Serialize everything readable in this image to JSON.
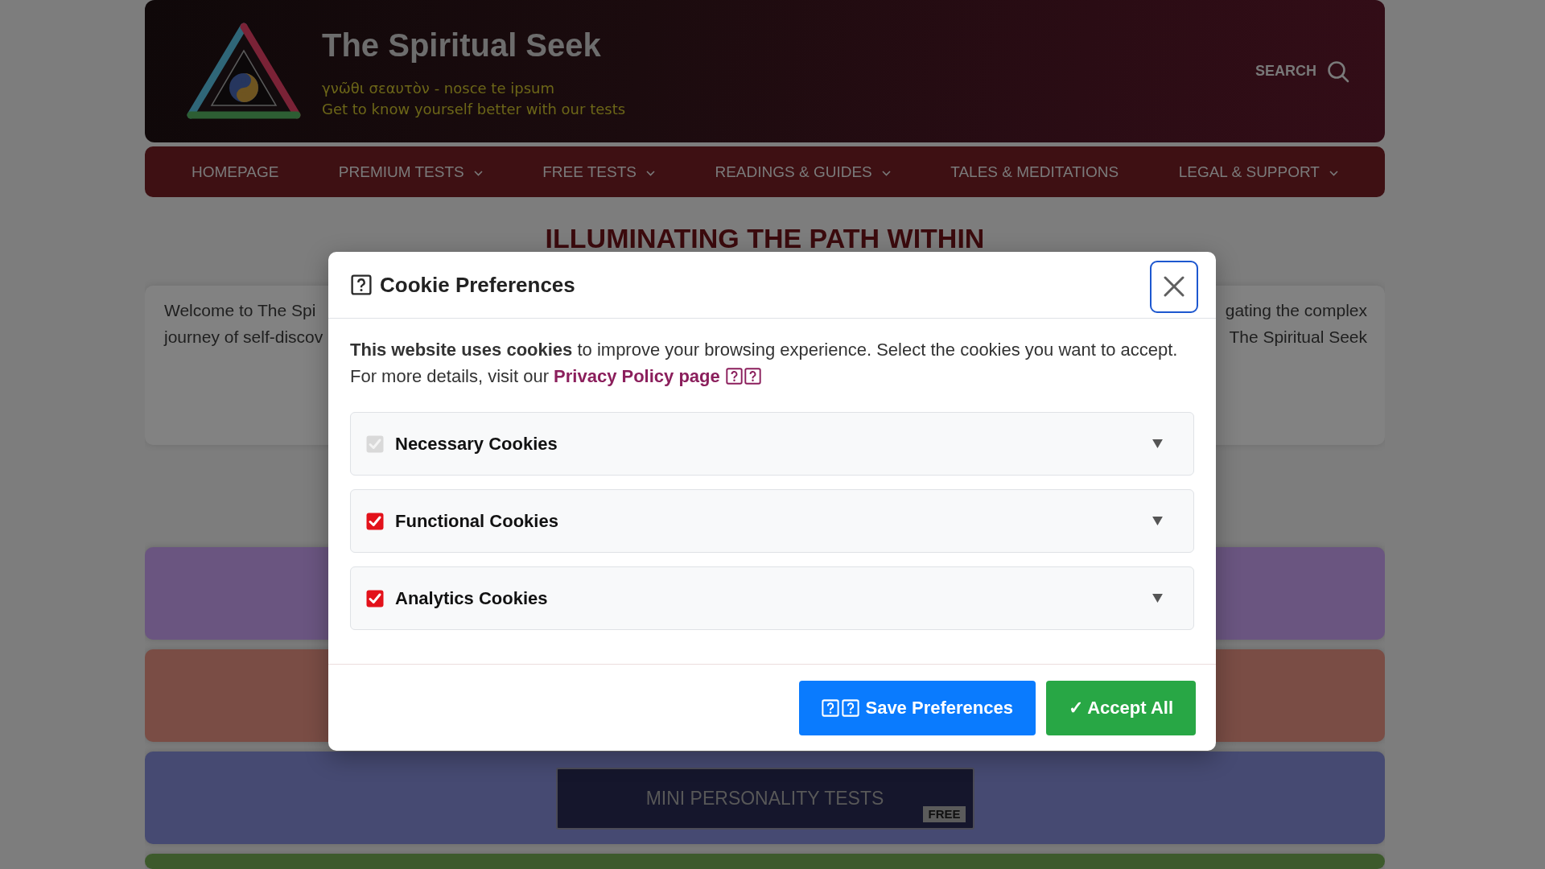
{
  "header": {
    "title": "The Spiritual Seek",
    "tagline_lines": [
      "γνῶθι σεαυτὸν - nosce te ipsum",
      "Get to know yourself better with our tests"
    ],
    "search_label": "SEARCH"
  },
  "nav": [
    {
      "label": "HOMEPAGE",
      "dropdown": false
    },
    {
      "label": "PREMIUM TESTS",
      "dropdown": true
    },
    {
      "label": "FREE TESTS",
      "dropdown": true
    },
    {
      "label": "READINGS & GUIDES",
      "dropdown": true
    },
    {
      "label": "TALES & MEDITATIONS",
      "dropdown": false
    },
    {
      "label": "LEGAL & SUPPORT",
      "dropdown": true
    }
  ],
  "heading": "ILLUMINATING THE PATH WITHIN",
  "intro": {
    "left_lines": [
      "Welcome to The Spi",
      "journey of self-discov"
    ],
    "right_lines": [
      "gating the complex",
      "The Spiritual Seek"
    ]
  },
  "sections": [
    {
      "color": "#6a5580"
    },
    {
      "color": "#7a4d45"
    },
    {
      "color": "#464a72",
      "tile": {
        "title": "MINI PERSONALITY TESTS",
        "badge": "FREE"
      }
    },
    {
      "color": "#3d5a2c"
    }
  ],
  "cookie_dialog": {
    "title": "Cookie Preferences",
    "close_focused": true,
    "message": "**This website uses cookies** to improve your browsing experience. Select the cookies you want to accept. For more details, visit our",
    "link": "Privacy Policy page",
    "categories": [
      {
        "label": "Necessary Cookies",
        "checked": true,
        "disabled": true,
        "expanded": false
      },
      {
        "label": "Functional Cookies",
        "checked": true,
        "disabled": false,
        "expanded": false
      },
      {
        "label": "Analytics Cookies",
        "checked": true,
        "disabled": false,
        "expanded": false
      }
    ],
    "buttons": [
      {
        "kind": "save",
        "label": "Save Preferences"
      },
      {
        "kind": "accept",
        "label": "✓ Accept All"
      }
    ]
  }
}
